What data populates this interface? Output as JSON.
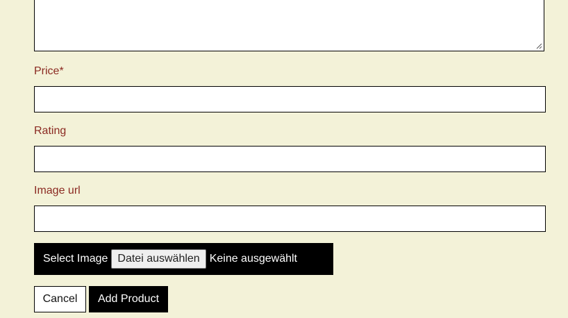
{
  "form": {
    "description_field": {
      "value": ""
    },
    "price": {
      "label": "Price*",
      "value": ""
    },
    "rating": {
      "label": "Rating",
      "value": ""
    },
    "image_url": {
      "label": "Image url",
      "value": ""
    },
    "image_upload": {
      "label": "Select Image",
      "choose_button": "Datei auswählen",
      "status": "Keine ausgewählt"
    },
    "actions": {
      "cancel": "Cancel",
      "submit": "Add Product"
    }
  },
  "colors": {
    "background": "#f3f2d8",
    "label": "#8b2a22",
    "primary_button": "#000000"
  }
}
